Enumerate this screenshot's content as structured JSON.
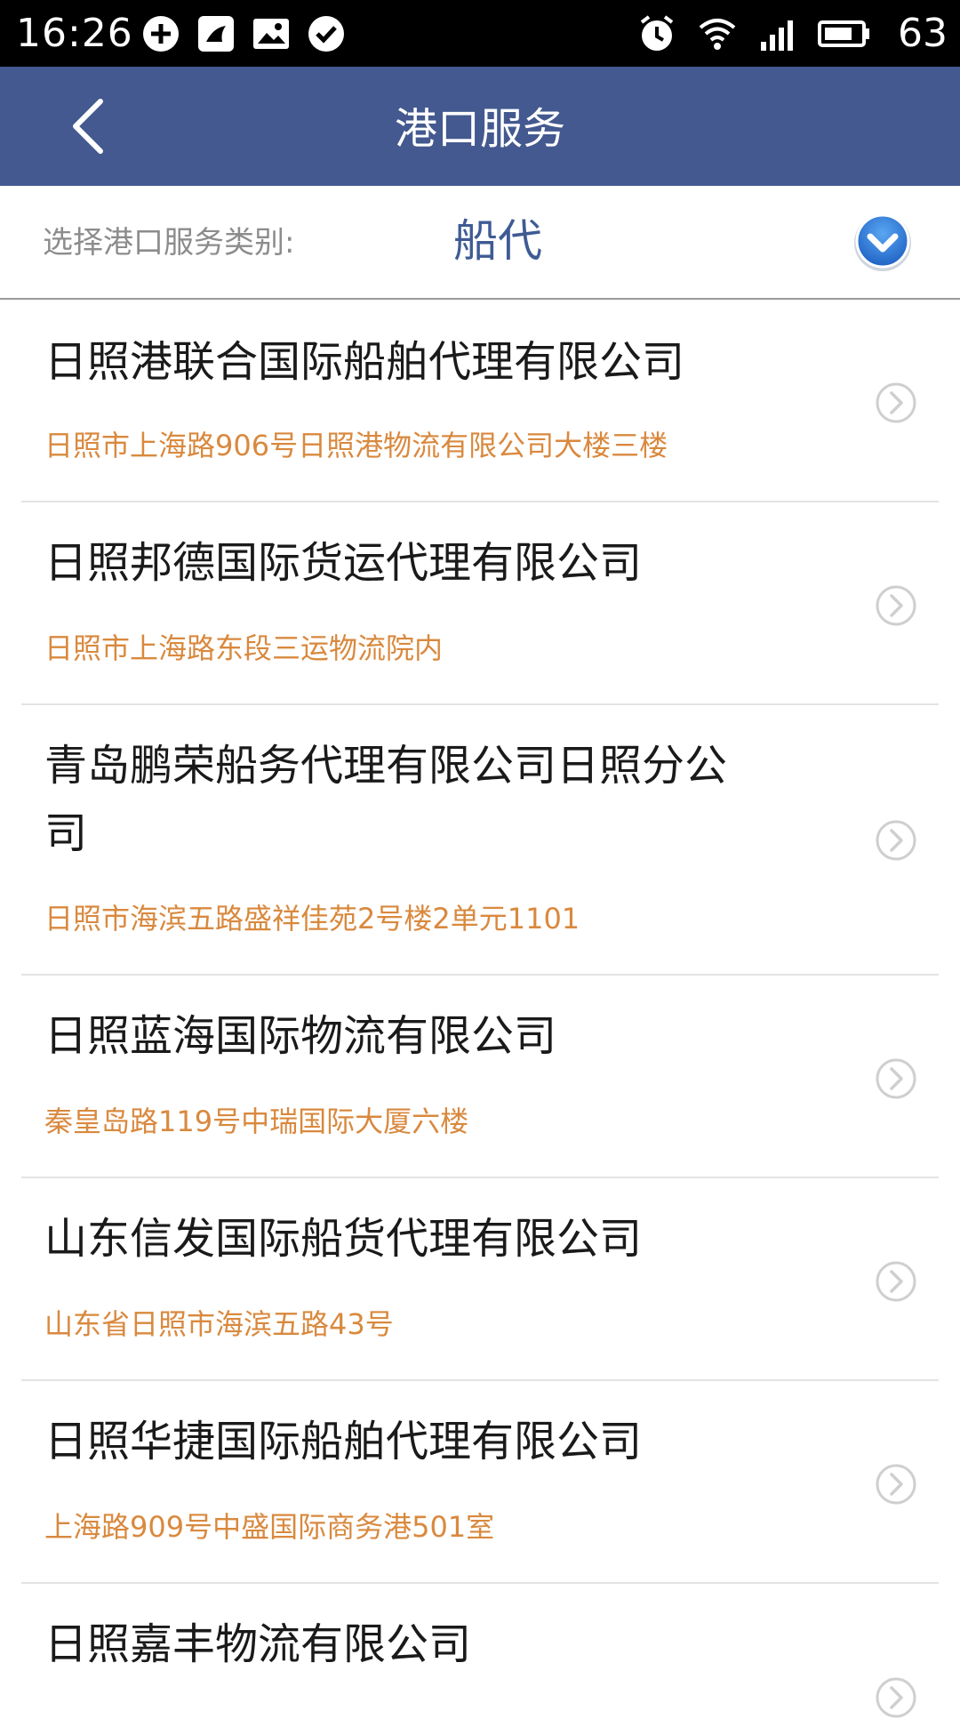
{
  "status_bar": {
    "time": "16:26",
    "battery": "63",
    "left_icons": [
      "sync-icon",
      "bird-app-icon",
      "gallery-icon",
      "check-circle-icon"
    ],
    "right_icons": [
      "alarm-icon",
      "wifi-icon",
      "signal-4g-icon",
      "battery-icon"
    ]
  },
  "header": {
    "title": "港口服务",
    "back_icon": "chevron-left-icon"
  },
  "selector": {
    "label": "选择港口服务类别:",
    "value": "船代",
    "accent_color": "#3f5b94"
  },
  "companies": [
    {
      "name": "日照港联合国际船舶代理有限公司",
      "address": "日照市上海路906号日照港物流有限公司大楼三楼"
    },
    {
      "name": "日照邦德国际货运代理有限公司",
      "address": "日照市上海路东段三运物流院内"
    },
    {
      "name": "青岛鹏荣船务代理有限公司日照分公司",
      "address": "日照市海滨五路盛祥佳苑2号楼2单元1101"
    },
    {
      "name": "日照蓝海国际物流有限公司",
      "address": "秦皇岛路119号中瑞国际大厦六楼"
    },
    {
      "name": "山东信发国际船货代理有限公司",
      "address": "山东省日照市海滨五路43号"
    },
    {
      "name": "日照华捷国际船舶代理有限公司",
      "address": "上海路909号中盛国际商务港501室"
    },
    {
      "name": "日照嘉丰物流有限公司",
      "address": ""
    }
  ],
  "colors": {
    "header_bg": "#43598f",
    "address_text": "#d9893e",
    "name_text": "#1a1a1a"
  }
}
